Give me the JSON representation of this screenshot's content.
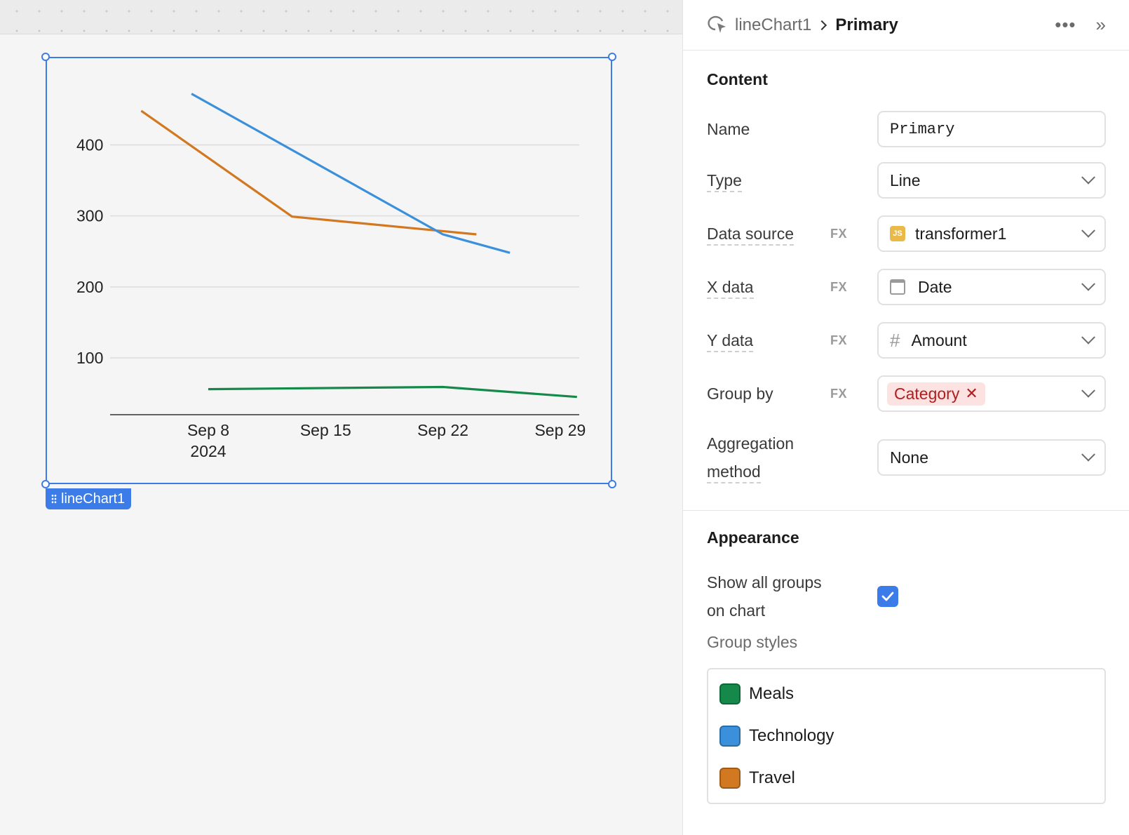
{
  "breadcrumb": {
    "parent": "lineChart1",
    "current": "Primary"
  },
  "canvas": {
    "component_label": "lineChart1"
  },
  "content": {
    "title": "Content",
    "name": {
      "label": "Name",
      "value": "Primary"
    },
    "type": {
      "label": "Type",
      "value": "Line"
    },
    "data_source": {
      "label": "Data source",
      "fx": "FX",
      "value": "transformer1",
      "icon_text": "JS"
    },
    "x_data": {
      "label": "X data",
      "fx": "FX",
      "value": "Date"
    },
    "y_data": {
      "label": "Y data",
      "fx": "FX",
      "value": "Amount"
    },
    "group_by": {
      "label": "Group by",
      "fx": "FX",
      "value": "Category"
    },
    "aggregation": {
      "label_line1": "Aggregation",
      "label_line2": "method",
      "value": "None"
    }
  },
  "appearance": {
    "title": "Appearance",
    "show_all_groups": {
      "label_line1": "Show all groups",
      "label_line2": "on chart",
      "checked": true
    },
    "group_styles": {
      "label": "Group styles",
      "items": [
        {
          "name": "Meals",
          "color": "#14894a"
        },
        {
          "name": "Technology",
          "color": "#3b90dc"
        },
        {
          "name": "Travel",
          "color": "#d27820"
        }
      ]
    }
  },
  "chart_data": {
    "type": "line",
    "x_tick_labels": [
      "Sep 8",
      "Sep 15",
      "Sep 22",
      "Sep 29"
    ],
    "x_tick_sublabel": "2024",
    "y_ticks": [
      100,
      200,
      300,
      400
    ],
    "series": [
      {
        "name": "Travel",
        "color": "#d27820",
        "points": [
          [
            "2024-09-04",
            448
          ],
          [
            "2024-09-13",
            299
          ],
          [
            "2024-09-24",
            274
          ]
        ]
      },
      {
        "name": "Technology",
        "color": "#3b90dc",
        "points": [
          [
            "2024-09-07",
            472
          ],
          [
            "2024-09-22",
            274
          ],
          [
            "2024-09-26",
            248
          ]
        ]
      },
      {
        "name": "Meals",
        "color": "#14894a",
        "points": [
          [
            "2024-09-08",
            56
          ],
          [
            "2024-09-22",
            59
          ],
          [
            "2024-09-30",
            45
          ]
        ]
      }
    ],
    "grid": true
  }
}
